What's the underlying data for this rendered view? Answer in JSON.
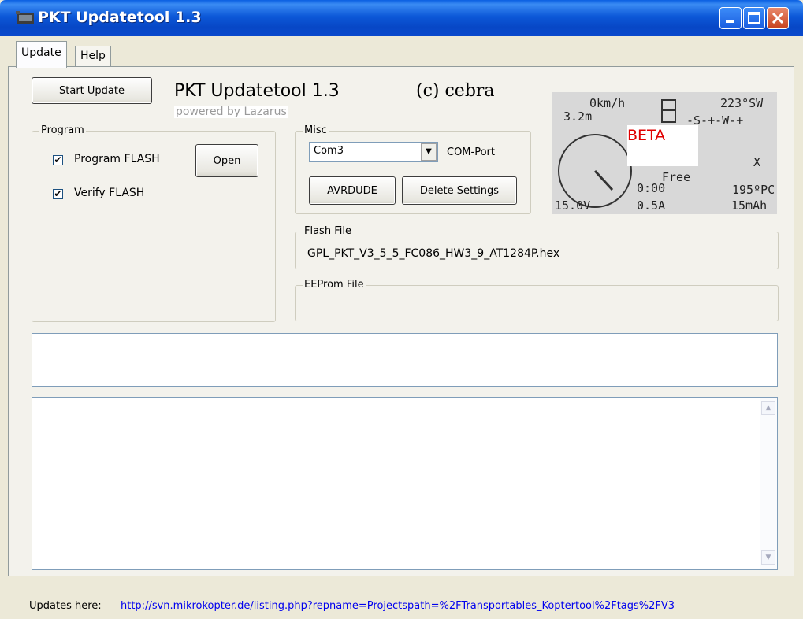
{
  "window": {
    "title": "PKT Updatetool 1.3",
    "icon": "app-icon",
    "controls": [
      "minimize-icon",
      "maximize-icon",
      "close-icon"
    ]
  },
  "tabs": [
    {
      "label": "Update",
      "active": true
    },
    {
      "label": "Help",
      "active": false
    }
  ],
  "header": {
    "start_button": "Start Update",
    "title": "PKT Updatetool 1.3",
    "copyright": "(c) cebra",
    "powered": "powered by Lazarus"
  },
  "program_group": {
    "title": "Program",
    "program_flash": {
      "label": "Program FLASH",
      "checked": true
    },
    "verify_flash": {
      "label": "Verify FLASH",
      "checked": true
    },
    "open_button": "Open"
  },
  "misc_group": {
    "title": "Misc",
    "port_value": "Com3",
    "port_label": "COM-Port",
    "avrdude_button": "AVRDUDE",
    "delete_button": "Delete Settings"
  },
  "lcd": {
    "speed": "0km/h",
    "altitude": "3.2m",
    "heading": "223°SW",
    "compass": "-S-+-W-+",
    "beta": "BETA",
    "free": "Free",
    "x": "X",
    "time": "0:00",
    "sats": "195ºPC",
    "voltage": "15.0V",
    "current": "0.5A",
    "capacity": "15mAh"
  },
  "flash_file": {
    "title": "Flash File",
    "value": "GPL_PKT_V3_5_5_FC086_HW3_9_AT1284P.hex"
  },
  "eeprom_file": {
    "title": "EEProm File",
    "value": ""
  },
  "status": {
    "label": "Updates here:",
    "link": "http://svn.mikrokopter.de/listing.php?repname=Projectspath=%2FTransportables_Koptertool%2Ftags%2FV3"
  },
  "colors": {
    "titlebar": "#0a5fe2",
    "close_button": "#c8411d",
    "beta_text": "#e00000",
    "link": "#0000ee",
    "window_bg": "#ece9d8"
  }
}
